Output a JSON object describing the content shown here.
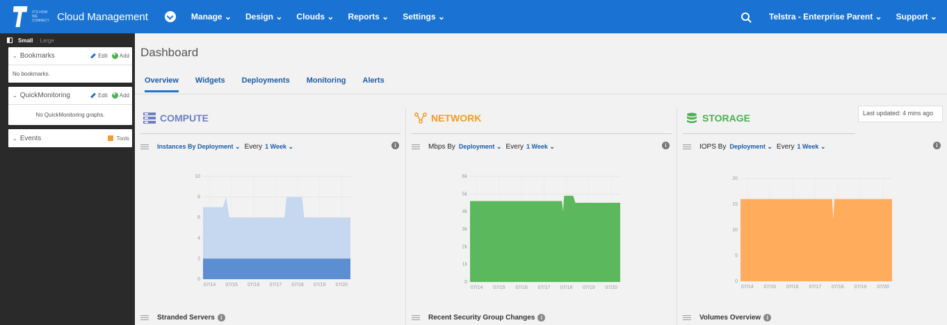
{
  "header": {
    "tagline": "IT'S HOW WE CONNECT",
    "app_title": "Cloud Management",
    "nav": [
      "Manage ⌄",
      "Design ⌄",
      "Clouds ⌄",
      "Reports ⌄",
      "Settings ⌄"
    ],
    "account": "Telstra - Enterprise Parent ⌄",
    "support": "Support ⌄"
  },
  "sidebar": {
    "size_small": "Small",
    "size_large": "Large",
    "bookmarks": {
      "title": "Bookmarks",
      "edit": "Edit",
      "add": "Add",
      "empty": "No bookmarks."
    },
    "quickmonitoring": {
      "title": "QuickMonitoring",
      "edit": "Edit",
      "add": "Add",
      "empty": "No QuickMonitoring graphs."
    },
    "events": {
      "title": "Events",
      "tools": "Tools"
    }
  },
  "main": {
    "title": "Dashboard",
    "tabs": [
      "Overview",
      "Widgets",
      "Deployments",
      "Monitoring",
      "Alerts"
    ],
    "active_tab": "Overview",
    "last_updated": "Last updated: 4 mins ago",
    "sections": {
      "compute": {
        "title": "COMPUTE",
        "metric": "Instances By Deployment ⌄",
        "every": "Every",
        "period": "1 Week ⌄",
        "bottom": "Stranded Servers",
        "color": "#6d7fc0"
      },
      "network": {
        "title": "NETWORK",
        "metric_prefix": "Mbps By",
        "metric": "Deployment ⌄",
        "every": "Every",
        "period": "1 Week ⌄",
        "bottom": "Recent Security Group Changes",
        "color": "#f39c1f"
      },
      "storage": {
        "title": "STORAGE",
        "metric_prefix": "IOPS By",
        "metric": "Deployment ⌄",
        "every": "Every",
        "period": "1 Week ⌄",
        "bottom": "Volumes Overview",
        "color": "#4caf50"
      }
    }
  },
  "chart_data": [
    {
      "type": "area",
      "title": "Instances By Deployment",
      "x": [
        "07/14",
        "07/15",
        "07/16",
        "07/17",
        "07/18",
        "07/19",
        "07/20"
      ],
      "ylim": [
        0,
        10
      ],
      "yticks": [
        0,
        2,
        4,
        6,
        8,
        10
      ],
      "series": [
        {
          "points": [
            [
              0,
              7
            ],
            [
              0.9,
              7
            ],
            [
              1.05,
              8
            ],
            [
              1.2,
              6
            ],
            [
              3.7,
              6
            ],
            [
              3.8,
              8
            ],
            [
              4.5,
              8
            ],
            [
              4.6,
              6
            ],
            [
              6.7,
              6
            ]
          ],
          "color": "#c5d8ef"
        },
        {
          "points": [
            [
              0,
              2
            ],
            [
              6.7,
              2
            ]
          ],
          "color": "#5b8fd2"
        }
      ]
    },
    {
      "type": "area",
      "title": "Mbps By Deployment",
      "x": [
        "07/14",
        "07/15",
        "07/16",
        "07/17",
        "07/18",
        "07/19",
        "07/20"
      ],
      "ylim": [
        0,
        6000
      ],
      "yticks": [
        "0",
        "1k",
        "2k",
        "3k",
        "4k",
        "5k",
        "6k"
      ],
      "series": [
        {
          "points": [
            [
              0,
              4600
            ],
            [
              4.1,
              4600
            ],
            [
              4.15,
              4000
            ],
            [
              4.2,
              4900
            ],
            [
              4.6,
              4900
            ],
            [
              4.7,
              4500
            ],
            [
              6.7,
              4500
            ]
          ],
          "color": "#5cb85c"
        }
      ]
    },
    {
      "type": "area",
      "title": "IOPS By Deployment",
      "x": [
        "07/14",
        "07/15",
        "07/16",
        "07/17",
        "07/18",
        "07/19",
        "07/20"
      ],
      "ylim": [
        0,
        20
      ],
      "yticks": [
        0,
        5,
        10,
        15,
        20
      ],
      "series": [
        {
          "points": [
            [
              0,
              16
            ],
            [
              4.05,
              16
            ],
            [
              4.1,
              12
            ],
            [
              4.15,
              16
            ],
            [
              6.7,
              16
            ]
          ],
          "color": "#ffad5c"
        }
      ]
    }
  ]
}
